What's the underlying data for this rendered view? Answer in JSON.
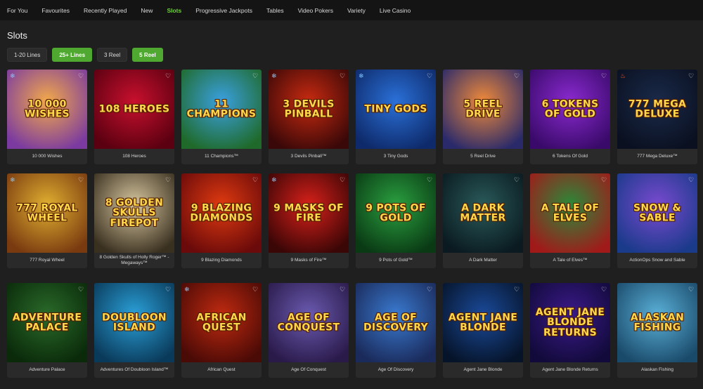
{
  "nav": {
    "items": [
      {
        "label": "For You",
        "active": false
      },
      {
        "label": "Favourites",
        "active": false
      },
      {
        "label": "Recently Played",
        "active": false
      },
      {
        "label": "New",
        "active": false
      },
      {
        "label": "Slots",
        "active": true
      },
      {
        "label": "Progressive Jackpots",
        "active": false
      },
      {
        "label": "Tables",
        "active": false
      },
      {
        "label": "Video Pokers",
        "active": false
      },
      {
        "label": "Variety",
        "active": false
      },
      {
        "label": "Live Casino",
        "active": false
      }
    ],
    "active_color": "#6fd13a"
  },
  "page": {
    "title": "Slots"
  },
  "filters": [
    {
      "label": "1-20 Lines",
      "active": false
    },
    {
      "label": "25+ Lines",
      "active": true
    },
    {
      "label": "3 Reel",
      "active": false
    },
    {
      "label": "5 Reel",
      "active": true
    }
  ],
  "games": [
    {
      "name": "10 000 Wishes",
      "art": "10 000 WISHES",
      "bg": [
        "#f3a94a",
        "#7a3aa0"
      ],
      "badge": "snowflake-icon"
    },
    {
      "name": "108 Heroes",
      "art": "108 HEROES",
      "bg": [
        "#c8102e",
        "#5a0010"
      ],
      "badge": ""
    },
    {
      "name": "11 Champions™",
      "art": "11 CHAMPIONS",
      "bg": [
        "#3aa0e0",
        "#1f6a2a"
      ],
      "badge": ""
    },
    {
      "name": "3 Devils Pinball™",
      "art": "3 DEVILS PINBALL",
      "bg": [
        "#c82a10",
        "#3a0808"
      ],
      "badge": "snowflake-icon"
    },
    {
      "name": "3 Tiny Gods",
      "art": "TINY GODS",
      "bg": [
        "#2a70d8",
        "#0e2a6a"
      ],
      "badge": "snowflake-icon"
    },
    {
      "name": "5 Reel Drive",
      "art": "5 REEL DRIVE",
      "bg": [
        "#f08a3a",
        "#2a2a6a"
      ],
      "badge": ""
    },
    {
      "name": "6 Tokens Of Gold",
      "art": "6 TOKENS OF GOLD",
      "bg": [
        "#8a2ad0",
        "#3a0a6a"
      ],
      "badge": ""
    },
    {
      "name": "777 Mega Deluxe™",
      "art": "777 MEGA DELUXE",
      "bg": [
        "#1a2a4a",
        "#0a1020"
      ],
      "badge": "fire-icon"
    },
    {
      "name": "777 Royal Wheel",
      "art": "777 ROYAL WHEEL",
      "bg": [
        "#e0b030",
        "#7a3a10"
      ],
      "badge": "snowflake-icon"
    },
    {
      "name": "8 Golden Skulls of Holly Roger™ - Megaways™",
      "art": "8 GOLDEN SKULLS FIREPOT",
      "bg": [
        "#d8c8a0",
        "#3a3020"
      ],
      "badge": ""
    },
    {
      "name": "9 Blazing Diamonds",
      "art": "9 BLAZING DIAMONDS",
      "bg": [
        "#e03a10",
        "#6a0a0a"
      ],
      "badge": ""
    },
    {
      "name": "9 Masks of Fire™",
      "art": "9 MASKS OF FIRE",
      "bg": [
        "#d8201a",
        "#3a0606"
      ],
      "badge": "snowflake-icon"
    },
    {
      "name": "9 Pots of Gold™",
      "art": "9 POTS OF GOLD",
      "bg": [
        "#2aa040",
        "#0a3a14"
      ],
      "badge": ""
    },
    {
      "name": "A Dark Matter",
      "art": "A DARK MATTER",
      "bg": [
        "#2a5a5a",
        "#0a1a20"
      ],
      "badge": ""
    },
    {
      "name": "A Tale of Elves™",
      "art": "A TALE OF ELVES",
      "bg": [
        "#2a8a3a",
        "#a01a1a"
      ],
      "badge": ""
    },
    {
      "name": "ActionOps Snow and Sable",
      "art": "SNOW & SABLE",
      "bg": [
        "#7a4ad0",
        "#1a3a8a"
      ],
      "badge": ""
    },
    {
      "name": "Adventure Palace",
      "art": "ADVENTURE PALACE",
      "bg": [
        "#2a6a2a",
        "#0a2a0a"
      ],
      "badge": ""
    },
    {
      "name": "Adventures Of Doubloon Island™",
      "art": "DOUBLOON ISLAND",
      "bg": [
        "#2aa0d8",
        "#0a3a5a"
      ],
      "badge": ""
    },
    {
      "name": "African Quest",
      "art": "AFRICAN QUEST",
      "bg": [
        "#c02a10",
        "#4a0a06"
      ],
      "badge": "snowflake-icon"
    },
    {
      "name": "Age Of Conquest",
      "art": "AGE OF CONQUEST",
      "bg": [
        "#6a5ab0",
        "#2a1a4a"
      ],
      "badge": ""
    },
    {
      "name": "Age Of Discovery",
      "art": "AGE OF DISCOVERY",
      "bg": [
        "#3a7ad0",
        "#1a2a5a"
      ],
      "badge": ""
    },
    {
      "name": "Agent Jane Blonde",
      "art": "AGENT JANE BLONDE",
      "bg": [
        "#1a4a9a",
        "#06142a"
      ],
      "badge": ""
    },
    {
      "name": "Agent Jane Blonde Returns",
      "art": "AGENT JANE BLONDE RETURNS",
      "bg": [
        "#3a1a8a",
        "#120a3a"
      ],
      "badge": ""
    },
    {
      "name": "Alaskan Fishing",
      "art": "ALASKAN FISHING",
      "bg": [
        "#5ab0d8",
        "#1a4a6a"
      ],
      "badge": ""
    }
  ]
}
